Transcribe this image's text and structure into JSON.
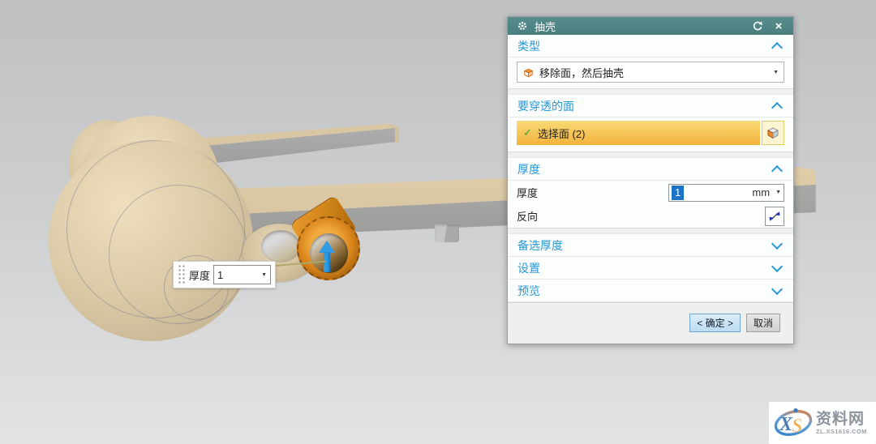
{
  "dialog": {
    "title": "抽壳",
    "close_glyph": "×",
    "caret": "▼",
    "type": {
      "header": "类型",
      "value": "移除面，然后抽壳"
    },
    "faces": {
      "header": "要穿透的面",
      "check": "✓",
      "selection": "选择面 (2)"
    },
    "thickness": {
      "header": "厚度",
      "label": "厚度",
      "value": "1",
      "unit": "mm",
      "reverse_label": "反向"
    },
    "alt": {
      "header": "备选厚度"
    },
    "settings": {
      "header": "设置"
    },
    "preview": {
      "header": "预览"
    },
    "ok": "< 确定 >",
    "cancel": "取消"
  },
  "floating": {
    "label": "厚度",
    "value": "1",
    "caret": "▼"
  },
  "watermark": {
    "logo_x": "X",
    "logo_s": "S",
    "name": "资料网",
    "url": "ZL.XS1616.COM"
  },
  "colors": {
    "titlebar_teal": "#4f8484",
    "accent_blue": "#2798d4",
    "selection_yellow": "#f2b33b",
    "selected_face_orange": "#d8841b",
    "arrow_blue": "#2f9ce5",
    "model_tan": "#d9c6a2",
    "input_selection_blue": "#1b74c8"
  }
}
